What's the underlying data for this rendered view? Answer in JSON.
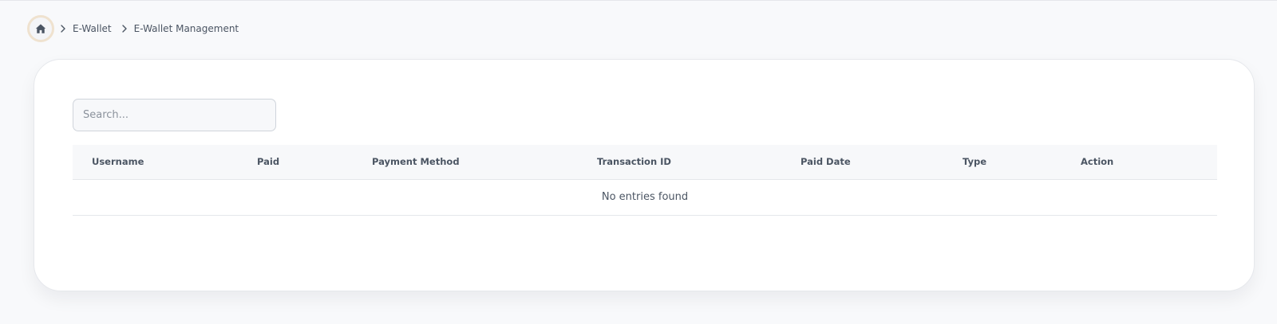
{
  "breadcrumb": {
    "home_icon": "home-icon",
    "separator_icon": "chevron-right-icon",
    "items": [
      "E-Wallet",
      "E-Wallet Management"
    ]
  },
  "search": {
    "placeholder": "Search...",
    "value": ""
  },
  "table": {
    "columns": [
      "Username",
      "Paid",
      "Payment Method",
      "Transaction ID",
      "Paid Date",
      "Type",
      "Action"
    ],
    "empty_message": "No entries found"
  },
  "colors": {
    "page_background": "#f8f9fb",
    "card_background": "#ffffff",
    "home_ring": "#efe2cf",
    "text": "#4b5563"
  }
}
